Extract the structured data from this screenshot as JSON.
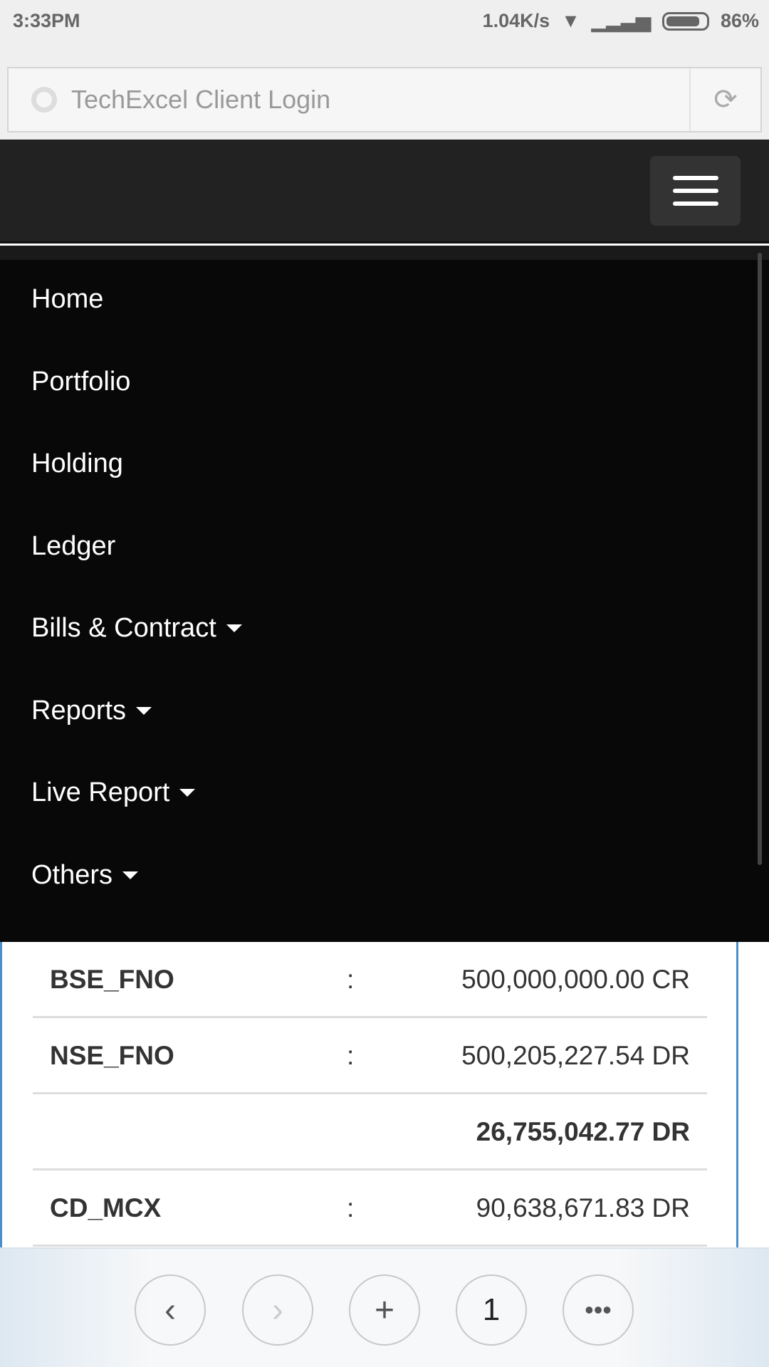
{
  "status_bar": {
    "time": "3:33PM",
    "net_speed": "1.04K/s",
    "battery": "86%",
    "battery_level": 86
  },
  "browser": {
    "page_title": "TechExcel Client Login"
  },
  "menu": {
    "items": [
      {
        "label": "Home",
        "dropdown": false
      },
      {
        "label": "Portfolio",
        "dropdown": false
      },
      {
        "label": "Holding",
        "dropdown": false
      },
      {
        "label": "Ledger",
        "dropdown": false
      },
      {
        "label": "Bills & Contract",
        "dropdown": true
      },
      {
        "label": "Reports",
        "dropdown": true
      },
      {
        "label": "Live Report",
        "dropdown": true
      },
      {
        "label": "Others",
        "dropdown": true
      }
    ]
  },
  "ledger": {
    "rows": [
      {
        "label": "BSE_FNO",
        "sep": ":",
        "value": "500,000,000.00 CR"
      },
      {
        "label": "NSE_FNO",
        "sep": ":",
        "value": "500,205,227.54 DR"
      },
      {
        "label": "",
        "sep": "",
        "value": "26,755,042.77 DR",
        "total": true
      },
      {
        "label": "CD_MCX",
        "sep": ":",
        "value": "90,638,671.83 DR"
      }
    ]
  },
  "bottom_bar": {
    "tabs_count": "1"
  },
  "colors": {
    "navbar": "#222222",
    "menu": "#080808",
    "border_accent": "#4a8fc9"
  }
}
